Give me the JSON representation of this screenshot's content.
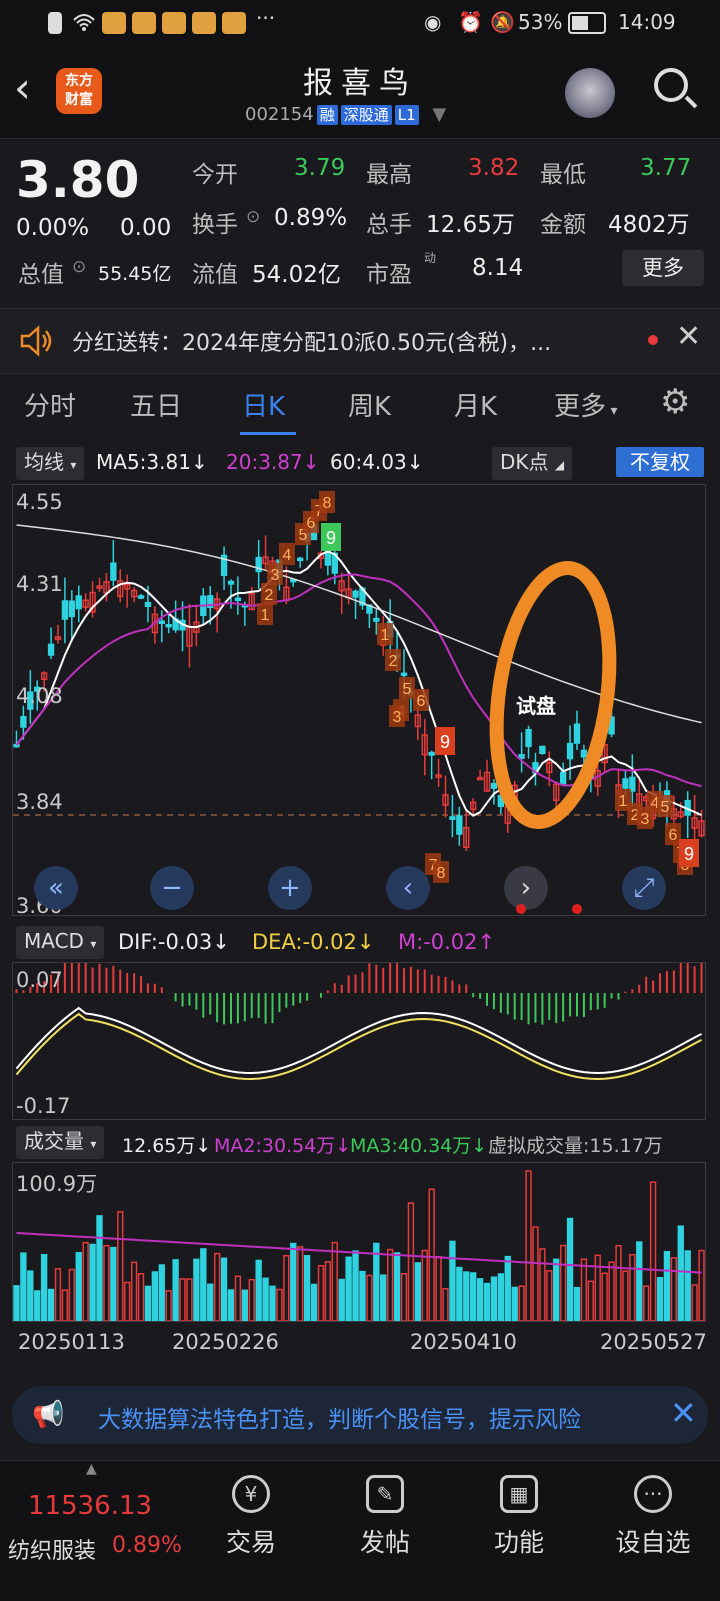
{
  "status": {
    "battery": "53%",
    "time": "14:09"
  },
  "header": {
    "back_icon": "chevron-left-icon",
    "logo_line1": "东方",
    "logo_line2": "财富",
    "title": "报喜鸟",
    "code": "002154",
    "tags": [
      "融",
      "深股通",
      "L1"
    ]
  },
  "quote": {
    "price": "3.80",
    "change_pct": "0.00%",
    "change": "0.00",
    "open_label": "今开",
    "open": "3.79",
    "high_label": "最高",
    "high": "3.82",
    "low_label": "最低",
    "low": "3.77",
    "turnover_label": "换手",
    "turnover": "0.89%",
    "volume_label": "总手",
    "volume": "12.65万",
    "amount_label": "金额",
    "amount": "4802万",
    "mktcap_label": "总值",
    "mktcap": "55.45亿",
    "float_label": "流值",
    "float": "54.02亿",
    "pe_label": "市盈",
    "pe_sup": "动",
    "pe": "8.14",
    "more": "更多"
  },
  "notice": {
    "text": "分红送转：2024年度分配10派0.50元(含税)，..."
  },
  "tabs": [
    "分时",
    "五日",
    "日K",
    "周K",
    "月K",
    "更多"
  ],
  "ma": {
    "selector": "均线",
    "ma5": "MA5:3.81",
    "ma20": "20:3.87",
    "ma60": "60:4.03",
    "dk": "DK点",
    "adjust": "不复权"
  },
  "kline": {
    "y_labels": [
      "4.55",
      "4.31",
      "4.08",
      "3.84",
      "3.60"
    ],
    "annotation": "试盘"
  },
  "macd": {
    "selector": "MACD",
    "dif": "DIF:-0.03",
    "dea": "DEA:-0.02",
    "m": "M:-0.02",
    "top": "0.07",
    "bottom": "-0.17"
  },
  "vol": {
    "selector": "成交量",
    "vol": "12.65万",
    "ma2": "MA2:30.54万",
    "ma3": "MA3:40.34万",
    "virtual": "虚拟成交量:15.17万",
    "top": "100.9万"
  },
  "dates": [
    "20250113",
    "20250226",
    "20250410",
    "20250527"
  ],
  "banner": {
    "text": "大数据算法特色打造，判断个股信号，提示风险"
  },
  "bottom": {
    "index_value": "11536.13",
    "sector": "纺织服装",
    "sector_pct": "0.89%",
    "nav": [
      "交易",
      "发帖",
      "功能",
      "设自选"
    ]
  },
  "colors": {
    "up": "#e53b3b",
    "down": "#2fd3e0",
    "accent": "#3a82f0",
    "orange": "#f08a24"
  }
}
